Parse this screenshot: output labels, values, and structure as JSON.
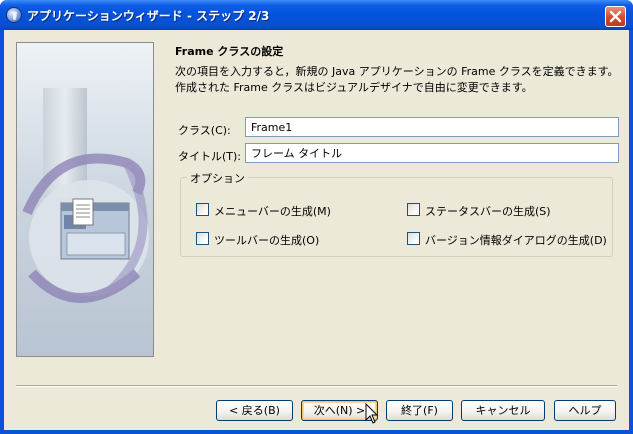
{
  "window": {
    "title": "アプリケーションウィザード - ステップ 2/3",
    "close_symbol": "✕"
  },
  "content": {
    "heading": "Frame クラスの設定",
    "description_line1": "次の項目を入力すると，新規の Java アプリケーションの Frame クラスを定義できます。",
    "description_line2": "作成された Frame クラスはビジュアルデザイナで自由に変更できます。"
  },
  "fields": {
    "class_label": "クラス(C):",
    "class_value": "Frame1",
    "title_label": "タイトル(T):",
    "title_value": "フレーム タイトル"
  },
  "options": {
    "group_label": "オプション",
    "menubar_label": "メニューバーの生成(M)",
    "toolbar_label": "ツールバーの生成(O)",
    "statusbar_label": "ステータスバーの生成(S)",
    "aboutdialog_label": "バージョン情報ダイアログの生成(D)",
    "menubar_checked": false,
    "toolbar_checked": false,
    "statusbar_checked": false,
    "aboutdialog_checked": false
  },
  "buttons": {
    "back": "< 戻る(B)",
    "next": "次へ(N) >",
    "finish": "終了(F)",
    "cancel": "キャンセル",
    "help": "ヘルプ"
  },
  "colors": {
    "titlebar": "#0453dc",
    "dialog_bg": "#ece9d8",
    "close_button": "#d2492b",
    "default_button_glow": "#f2c373"
  }
}
